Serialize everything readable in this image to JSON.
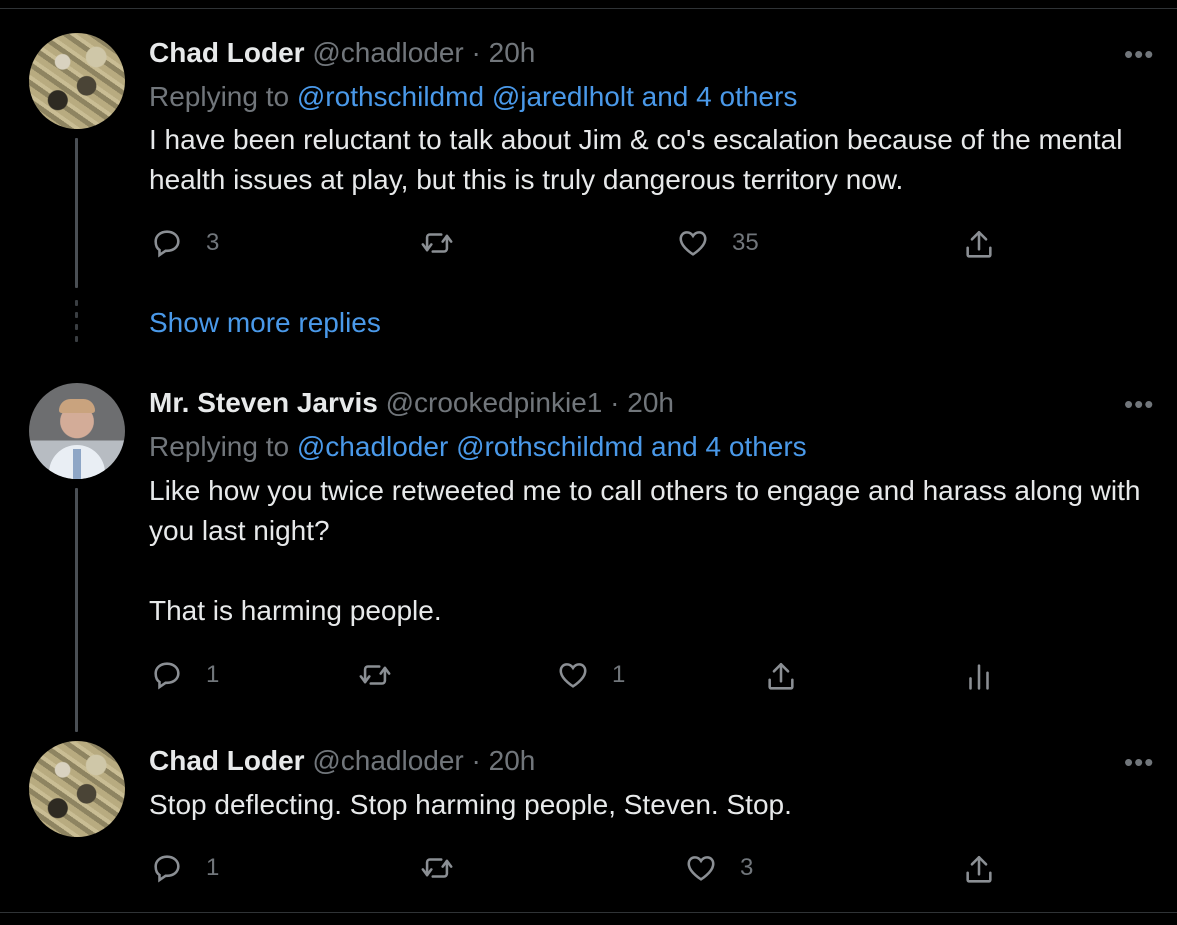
{
  "tweets": [
    {
      "name": "Chad Loder",
      "handle": "@chadloder",
      "separator": "·",
      "time": "20h",
      "replying_prefix": "Replying to",
      "replying_links": [
        "@rothschildmd",
        "@jaredlholt",
        "and 4 others"
      ],
      "text": [
        "I have been reluctant to talk about Jim & co's escalation because of the mental health issues at play, but this is truly dangerous territory now."
      ],
      "stats": {
        "replies": "3",
        "retweets": "",
        "likes": "35"
      }
    },
    {
      "name": "Mr. Steven Jarvis",
      "handle": "@crookedpinkie1",
      "separator": "·",
      "time": "20h",
      "replying_prefix": "Replying to",
      "replying_links": [
        "@chadloder",
        "@rothschildmd",
        "and 4 others"
      ],
      "text": [
        "Like how you twice retweeted me to call others to engage and harass along with you last night?",
        "That is harming people."
      ],
      "stats": {
        "replies": "1",
        "retweets": "",
        "likes": "1"
      }
    },
    {
      "name": "Chad Loder",
      "handle": "@chadloder",
      "separator": "·",
      "time": "20h",
      "text": [
        "Stop deflecting. Stop harming people, Steven. Stop."
      ],
      "stats": {
        "replies": "1",
        "retweets": "",
        "likes": "3"
      }
    }
  ],
  "show_more_replies": "Show more replies",
  "more_glyph": "•••",
  "icons": [
    "reply-icon",
    "retweet-icon",
    "like-icon",
    "share-icon",
    "analytics-icon"
  ],
  "colors": {
    "background": "#000000",
    "text": "#e7e9ea",
    "muted": "#71767b",
    "link": "#4a99e9"
  }
}
